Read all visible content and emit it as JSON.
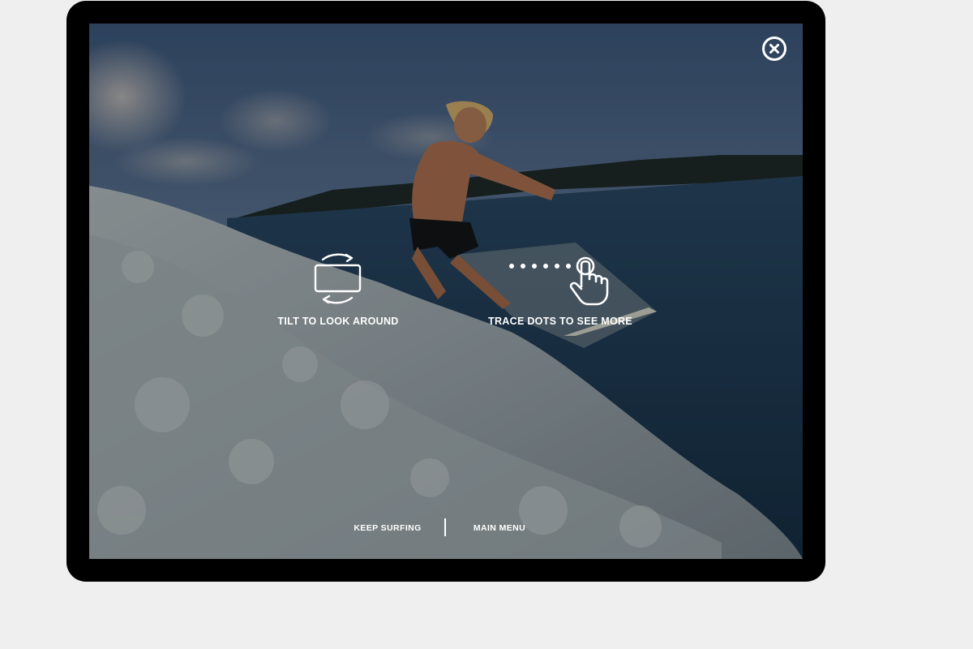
{
  "overlay": {
    "close_icon": "close-icon",
    "hints": [
      {
        "icon": "tilt-device-icon",
        "label": "TILT TO LOOK AROUND"
      },
      {
        "icon": "trace-dots-hand-icon",
        "label": "TRACE DOTS TO SEE MORE"
      }
    ],
    "footer": {
      "keep_surfing": "KEEP SURFING",
      "main_menu": "MAIN MENU"
    }
  },
  "colors": {
    "device_frame": "#000000",
    "page_background": "#efefef",
    "overlay_text": "#ffffff"
  }
}
